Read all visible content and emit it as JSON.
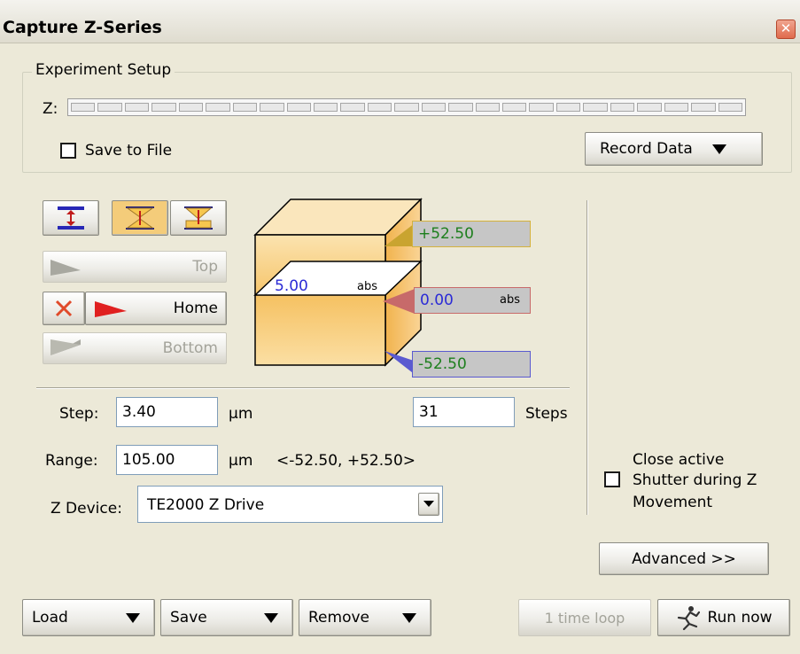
{
  "window": {
    "title": "Capture Z-Series"
  },
  "experiment_setup": {
    "group_label": "Experiment Setup",
    "z_label": "Z:",
    "z_segments": 25,
    "save_to_file_label": "Save to File",
    "save_to_file_checked": false,
    "record_data_label": "Record Data"
  },
  "position_buttons": {
    "top_label": "Top",
    "home_label": "Home",
    "bottom_label": "Bottom"
  },
  "cube": {
    "top_value": "+52.50",
    "current_value": "5.00",
    "current_unit": "abs",
    "home_value": "0.00",
    "home_unit": "abs",
    "bottom_value": "-52.50"
  },
  "step": {
    "label": "Step:",
    "value": "3.40",
    "unit": "µm",
    "steps_value": "31",
    "steps_label": "Steps"
  },
  "range": {
    "label": "Range:",
    "value": "105.00",
    "unit": "µm",
    "bounds": "<-52.50, +52.50>"
  },
  "z_device": {
    "label": "Z Device:",
    "value": "TE2000 Z Drive"
  },
  "shutter": {
    "label_line1": "Close active",
    "label_line2": "Shutter during Z",
    "label_line3": "Movement",
    "checked": false
  },
  "advanced_label": "Advanced >>",
  "footer": {
    "load_label": "Load",
    "save_label": "Save",
    "remove_label": "Remove",
    "loop_label": "1 time loop",
    "run_label": "Run now"
  },
  "colors": {
    "top_box_bg": "#c6c6c6",
    "top_box_border": "#d4b23c",
    "top_text": "#1d7f1d",
    "home_box_bg": "#c6c6c6",
    "home_box_border": "#c76a6a",
    "home_text": "#2b2bd6",
    "bottom_box_bg": "#c6c6c6",
    "bottom_box_border": "#5a5ad0",
    "bottom_text": "#1d7f1d",
    "cube_fill": "#f7c56a",
    "home_marker": "#e02020"
  }
}
